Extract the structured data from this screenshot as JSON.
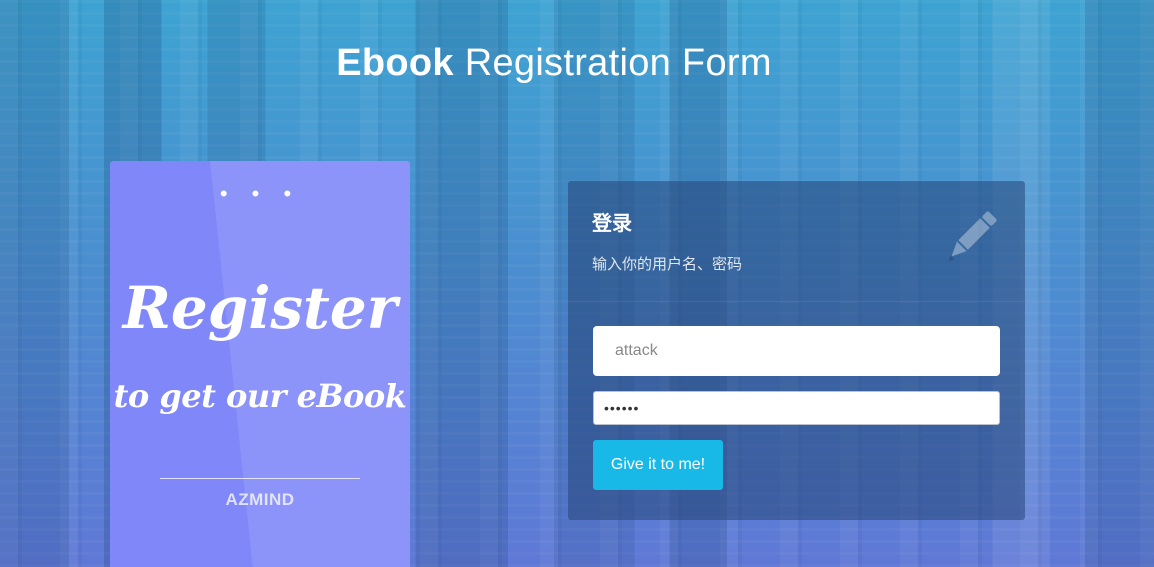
{
  "header": {
    "title_strong": "Ebook",
    "title_rest": "Registration Form"
  },
  "promo": {
    "dots": "• • •",
    "heading": "Register",
    "subheading": "to get our eBook",
    "brand": "AZMIND"
  },
  "login": {
    "title": "登录",
    "description": "输入你的用户名、密码",
    "username_value": "attack",
    "password_mask": "••••••",
    "submit_label": "Give it to me!",
    "icon": "pencil-icon"
  },
  "colors": {
    "promo_card": "#7f87f9",
    "submit_button": "#19b9e7",
    "panel": "rgba(38,70,120,0.55)"
  }
}
